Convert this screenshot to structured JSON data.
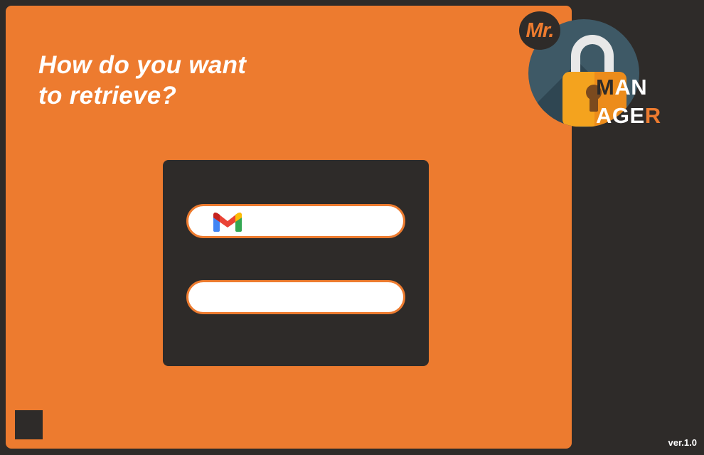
{
  "prompt": {
    "line1": "How do you want",
    "line2": "to retrieve?"
  },
  "options": [
    {
      "icon": "gmail-icon",
      "label": ""
    },
    {
      "icon": "",
      "label": ""
    }
  ],
  "logo": {
    "mr": "Mr.",
    "line1_first": "M",
    "line1_rest": "AN",
    "line2_main": "AGE",
    "line2_last": "R"
  },
  "version": "ver.1.0",
  "colors": {
    "accent": "#ed7b2f",
    "dark": "#2e2b29",
    "white": "#ffffff"
  }
}
